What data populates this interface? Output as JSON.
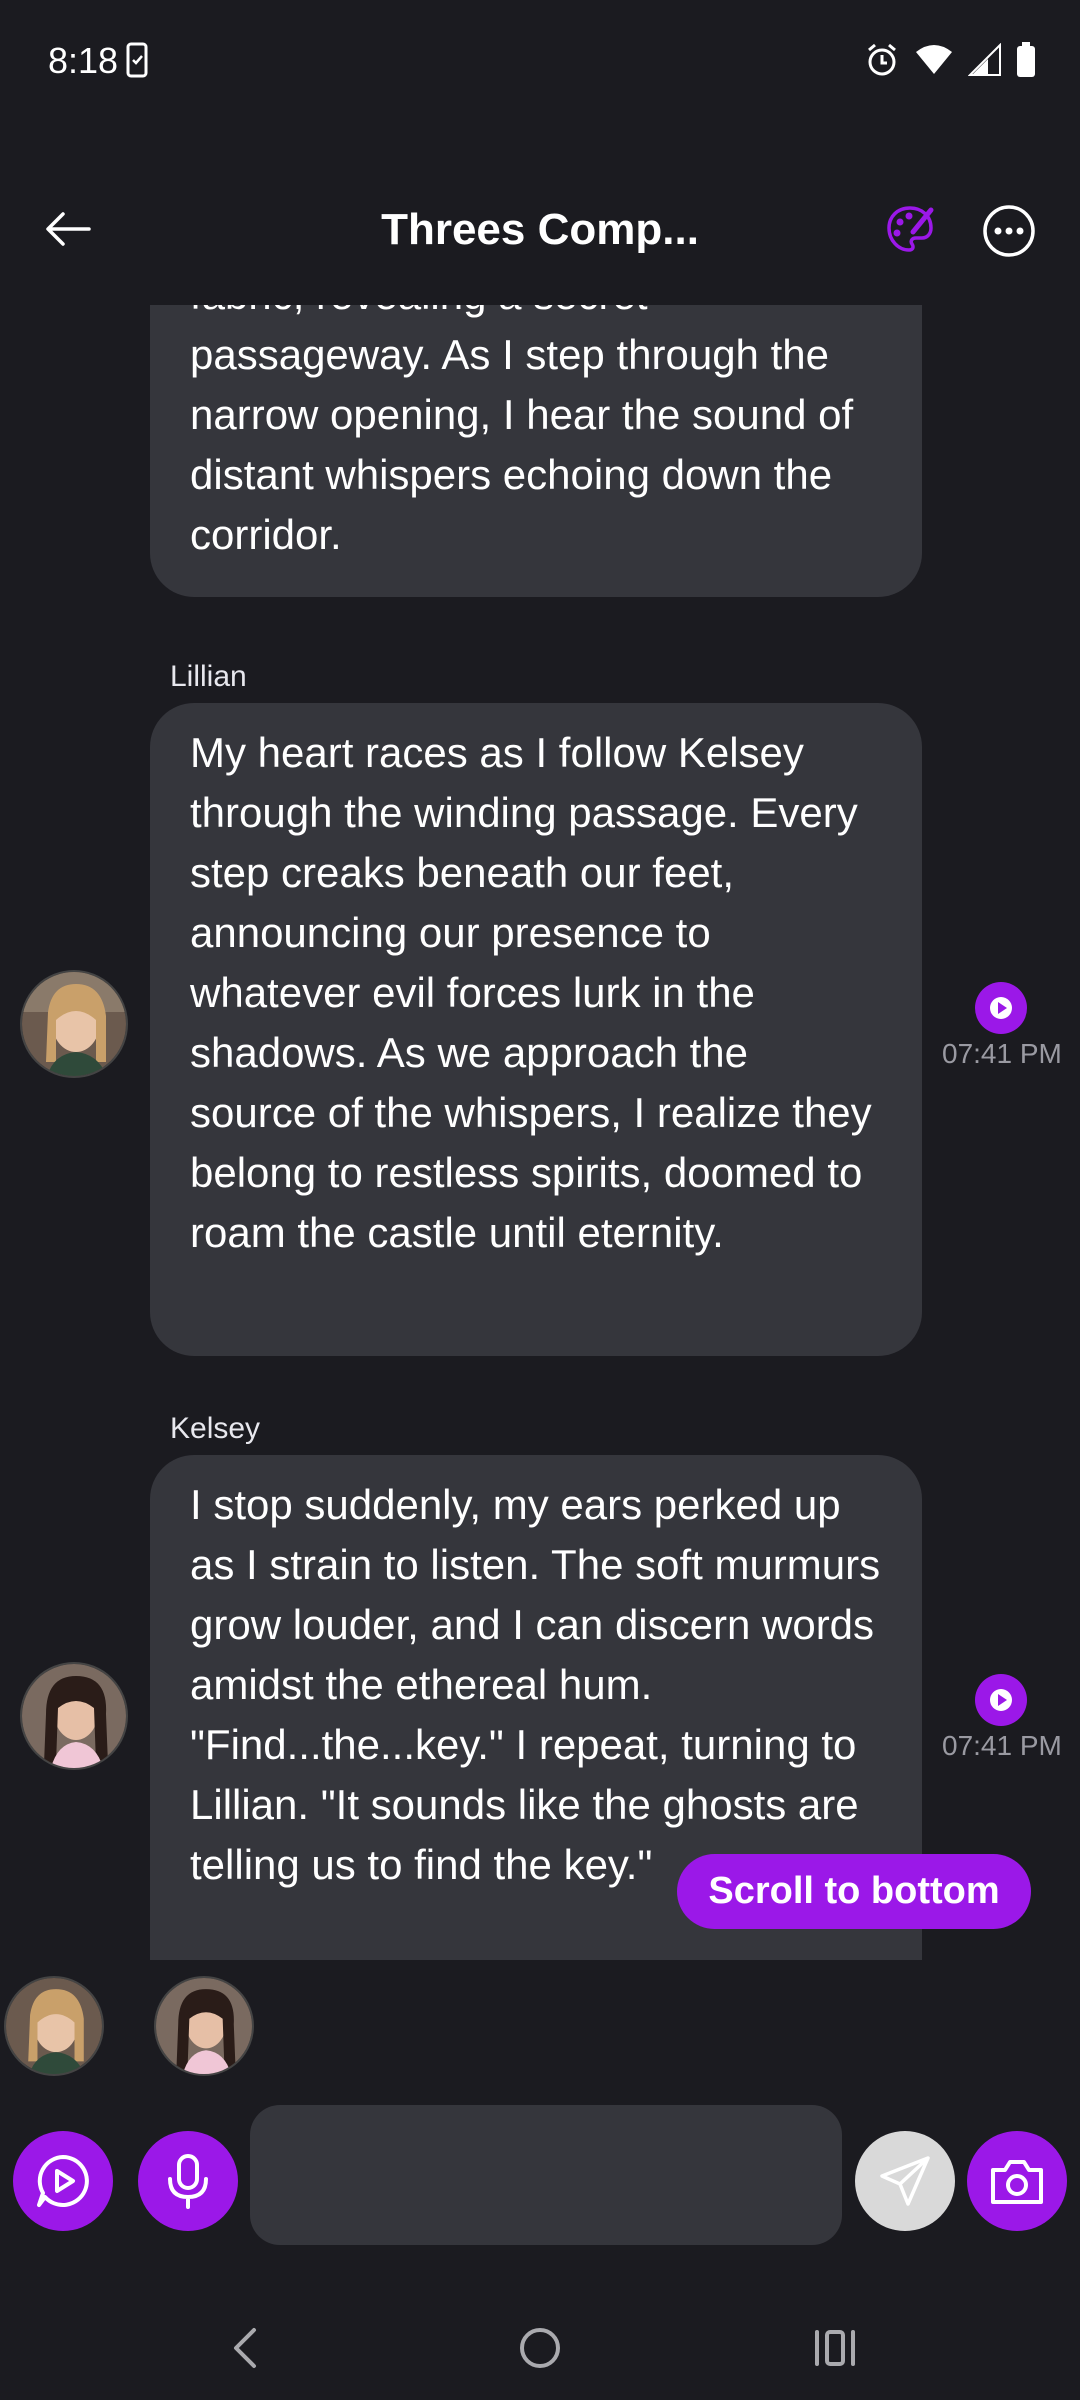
{
  "status_bar": {
    "time": "8:18"
  },
  "header": {
    "title": "Threes Comp..."
  },
  "messages": [
    {
      "sender": "",
      "text": "fabric, revealing a secret passageway. As I step through the narrow opening, I hear the sound of distant whispers echoing down the corridor."
    },
    {
      "sender": "Lillian",
      "text": "My heart races as I follow Kelsey through the winding passage. Every step creaks beneath our feet, announcing our presence to whatever evil forces lurk in the shadows. As we approach the source of the whispers, I realize they belong to restless spirits, doomed to roam the castle until eternity.",
      "time": "07:41 PM"
    },
    {
      "sender": "Kelsey",
      "text": "I stop suddenly, my ears perked up as I strain to listen. The soft murmurs grow louder, and I can discern words amidst the ethereal hum. \"Find...the...key.\" I repeat, turning to Lillian. \"It sounds like the ghosts are telling us to find the key.\"",
      "time": "07:41 PM"
    }
  ],
  "scroll_to_bottom_label": "Scroll to bottom",
  "input": {
    "value": "",
    "placeholder": ""
  },
  "colors": {
    "accent": "#9b18e8",
    "background": "#1b1b20",
    "bubble": "#35363c"
  },
  "icons": {
    "back": "arrow-left-icon",
    "palette": "palette-icon",
    "more": "more-horizontal-icon",
    "play": "play-icon",
    "video_play": "video-play-icon",
    "mic": "microphone-icon",
    "send": "send-icon",
    "camera": "camera-icon"
  }
}
